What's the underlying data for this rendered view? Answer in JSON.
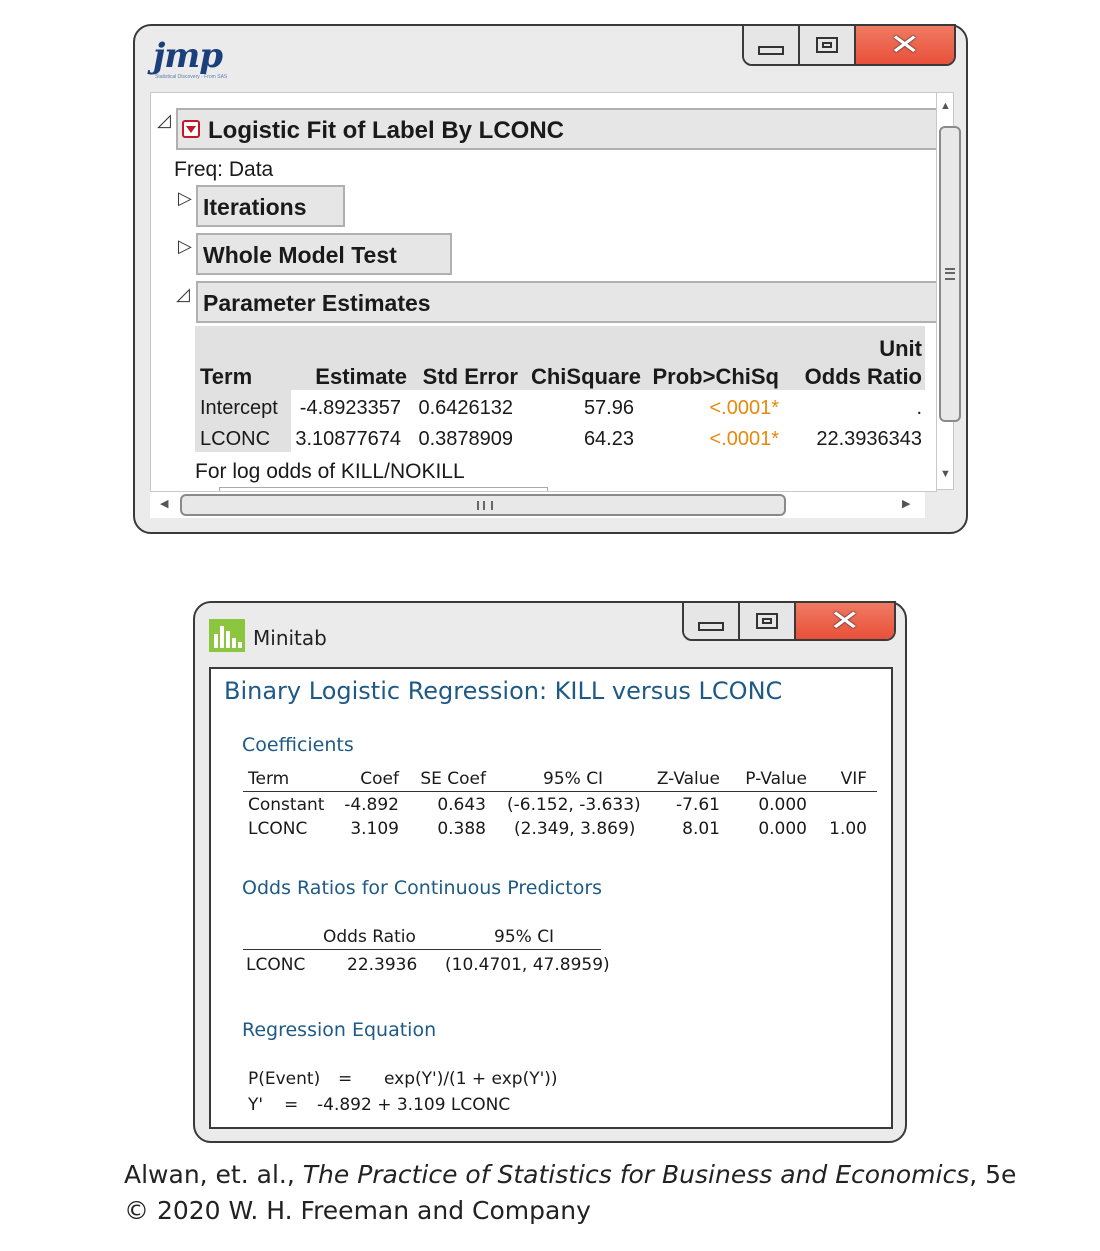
{
  "jmp": {
    "logo": "jmp",
    "logo_tagline": "Statistical Discovery · From SAS",
    "title": "Logistic Fit of Label By LCONC",
    "freq": "Freq: Data",
    "iterations_label": "Iterations",
    "whole_model_label": "Whole Model Test",
    "param_label": "Parameter Estimates",
    "table": {
      "headers": {
        "term": "Term",
        "estimate": "Estimate",
        "std_error": "Std Error",
        "chisquare": "ChiSquare",
        "prob": "Prob>ChiSq",
        "unit": "Unit",
        "odds_ratio": "Odds Ratio"
      },
      "rows": [
        {
          "term": "Intercept",
          "estimate": "-4.8923357",
          "std_error": "0.6426132",
          "chisquare": "57.96",
          "prob": "<.0001*",
          "odds": "."
        },
        {
          "term": "LCONC",
          "estimate": "3.10877674",
          "std_error": "0.3878909",
          "chisquare": "64.23",
          "prob": "<.0001*",
          "odds": "22.3936343"
        }
      ]
    },
    "footnote": "For log odds of KILL/NOKILL"
  },
  "minitab": {
    "app_name": "Minitab",
    "title": "Binary Logistic Regression: KILL versus LCONC",
    "coefficients": {
      "heading": "Coefficients",
      "headers": {
        "term": "Term",
        "coef": "Coef",
        "se": "SE Coef",
        "ci": "95% CI",
        "z": "Z-Value",
        "p": "P-Value",
        "vif": "VIF"
      },
      "rows": [
        {
          "term": "Constant",
          "coef": "-4.892",
          "se": "0.643",
          "ci": "(-6.152, -3.633)",
          "z": "-7.61",
          "p": "0.000",
          "vif": ""
        },
        {
          "term": "LCONC",
          "coef": "3.109",
          "se": "0.388",
          "ci": "(2.349, 3.869)",
          "z": "8.01",
          "p": "0.000",
          "vif": "1.00"
        }
      ]
    },
    "odds": {
      "heading": "Odds Ratios for Continuous Predictors",
      "headers": {
        "odds_ratio": "Odds Ratio",
        "ci": "95% CI"
      },
      "row": {
        "term": "LCONC",
        "odds_ratio": "22.3936",
        "ci": "(10.4701, 47.8959)"
      }
    },
    "equation": {
      "heading": "Regression Equation",
      "line1_lhs": "P(Event)",
      "line1_eq": "=",
      "line1_rhs": "exp(Y')/(1 + exp(Y'))",
      "line2_lhs": "Y'",
      "line2_eq": "=",
      "line2_rhs": "-4.892 + 3.109 LCONC"
    }
  },
  "caption": {
    "authors": "Alwan, et. al., ",
    "book": "The Practice of Statistics for Business and Economics",
    "edition": ", 5e",
    "copyright": "© 2020 W. H. Freeman and Company"
  },
  "colors": {
    "minitab_heading": "#1e5a85",
    "jmp_significance": "#e8890c",
    "close_button": "#e8503a",
    "minitab_icon": "#8cc63f"
  },
  "icons": [
    "jmp-logo",
    "minitab-logo-icon",
    "minimize-icon",
    "maximize-icon",
    "close-icon",
    "red-triangle-menu-icon",
    "disclosure-icon",
    "scroll-arrow-icon"
  ]
}
